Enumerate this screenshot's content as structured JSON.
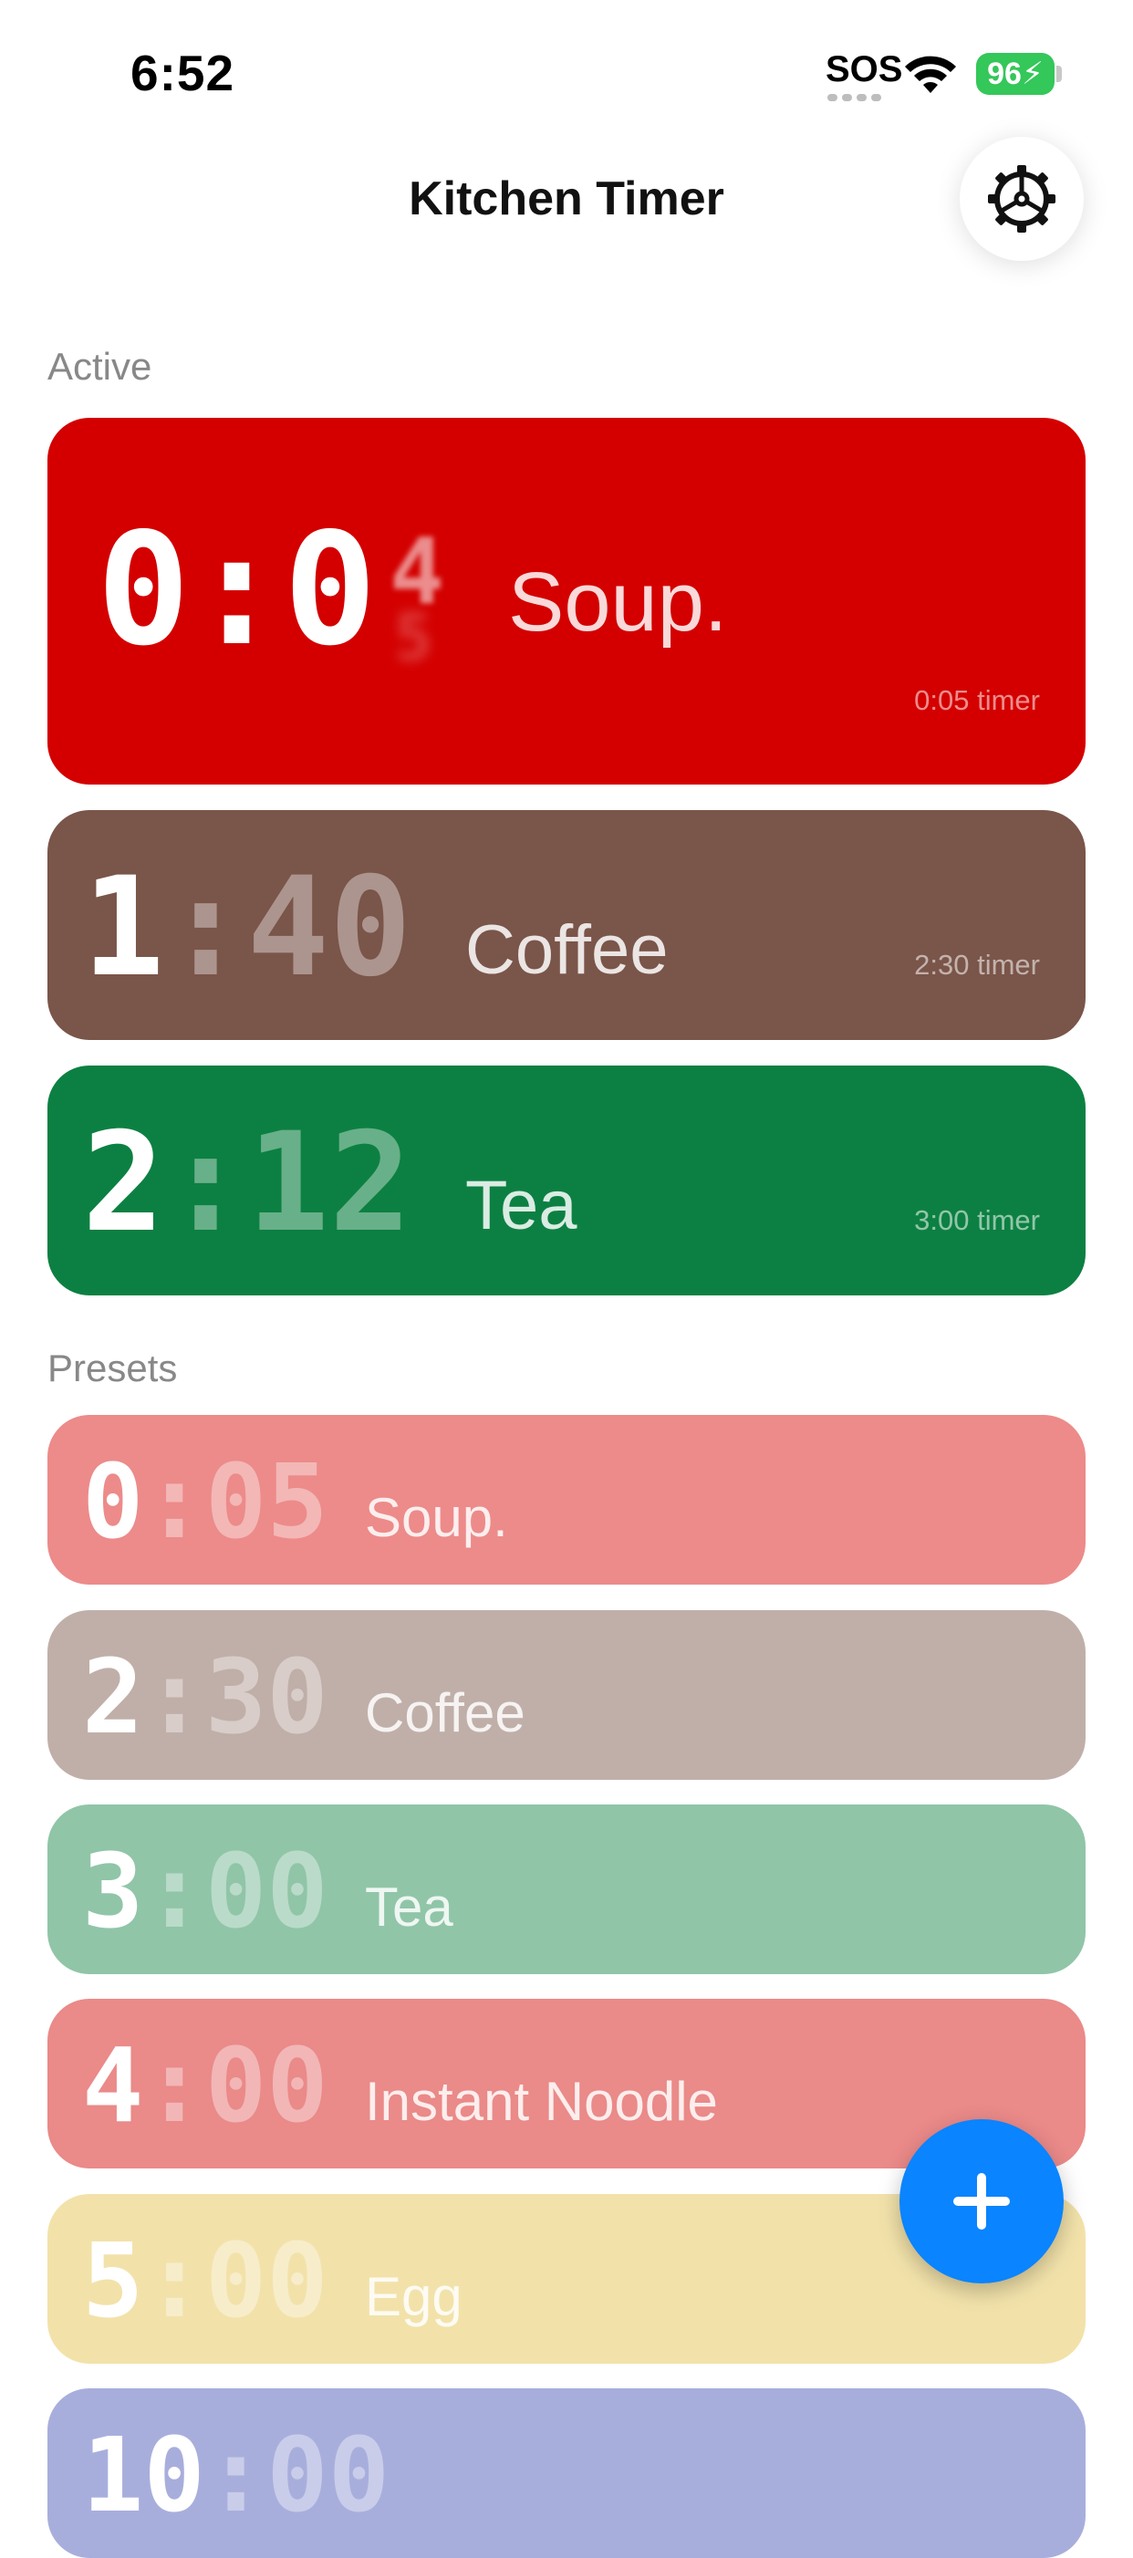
{
  "status_bar": {
    "time": "6:52",
    "sos": "SOS",
    "battery": "96"
  },
  "header": {
    "title": "Kitchen Timer",
    "settings_icon": "gear-icon"
  },
  "sections": {
    "active_label": "Active",
    "presets_label": "Presets"
  },
  "active": [
    {
      "minutes": "0",
      "seconds_shown": "0",
      "seconds_blur_top": "4",
      "seconds_blur_bottom": "5",
      "name": "Soup.",
      "subtitle": "0:05 timer",
      "color": "#d40000"
    },
    {
      "minutes": "1",
      "seconds": "40",
      "name": "Coffee",
      "subtitle": "2:30 timer",
      "color": "#7a5549"
    },
    {
      "minutes": "2",
      "seconds": "12",
      "name": "Tea",
      "subtitle": "3:00 timer",
      "color": "#0c8042"
    }
  ],
  "presets": [
    {
      "minutes": "0",
      "seconds": "05",
      "name": "Soup.",
      "color": "#ec8b8a"
    },
    {
      "minutes": "2",
      "seconds": "30",
      "name": "Coffee",
      "color": "#c0afa9"
    },
    {
      "minutes": "3",
      "seconds": "00",
      "name": "Tea",
      "color": "#90c5a8"
    },
    {
      "minutes": "4",
      "seconds": "00",
      "name": "Instant Noodle",
      "color": "#ea8a89"
    },
    {
      "minutes": "5",
      "seconds": "00",
      "name": "Egg",
      "color": "#f2e2aa"
    },
    {
      "minutes": "10",
      "seconds": "00",
      "name": "",
      "color": "#a8aedc"
    }
  ],
  "fab": {
    "icon": "plus-icon",
    "color": "#0a84ff"
  }
}
